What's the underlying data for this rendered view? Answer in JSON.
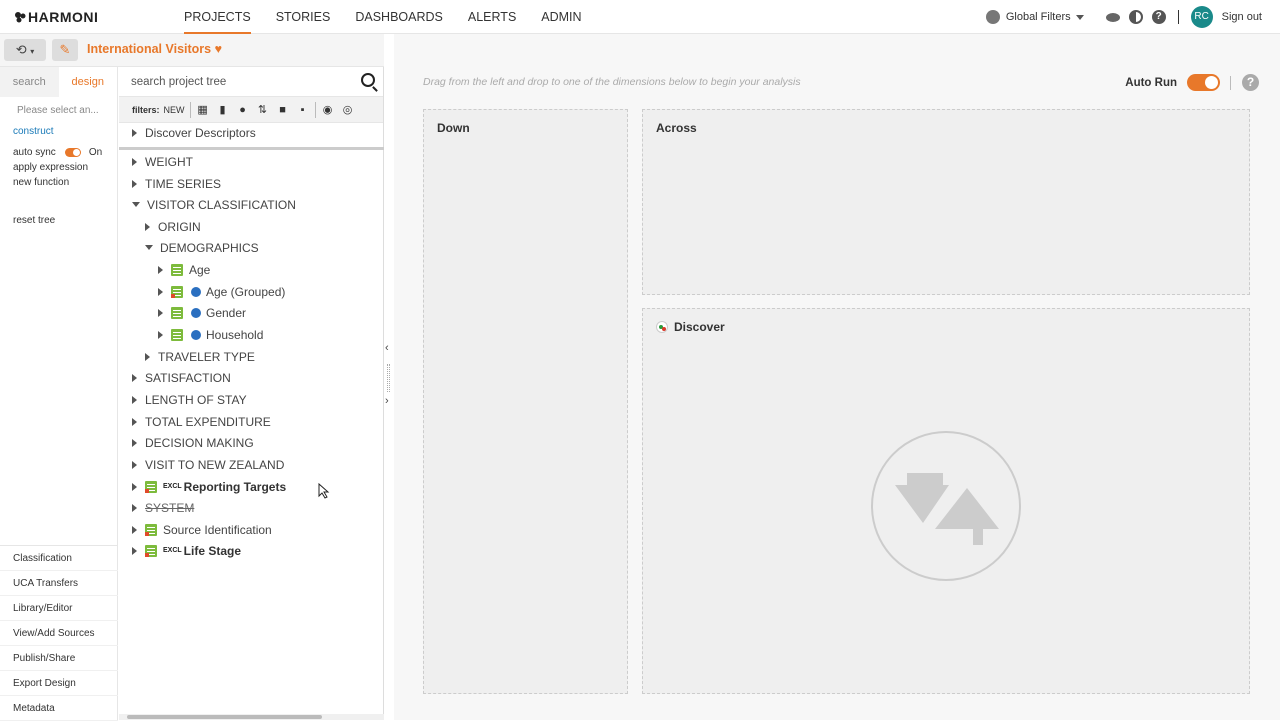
{
  "app": {
    "logo": "HARMONI"
  },
  "nav": {
    "items": [
      "PROJECTS",
      "STORIES",
      "DASHBOARDS",
      "ALERTS",
      "ADMIN"
    ],
    "active": "PROJECTS"
  },
  "topright": {
    "global_filters": "Global Filters",
    "avatar_initials": "RC",
    "signout": "Sign out"
  },
  "project": {
    "title": "International Visitors",
    "accent": "#e8782a"
  },
  "leftpanel": {
    "tabs": [
      "search",
      "design"
    ],
    "active_tab": "design",
    "please_select": "Please select an...",
    "construct": "construct",
    "auto_sync_label": "auto sync",
    "auto_sync_state": "On",
    "apply_expression": "apply expression",
    "new_function": "new function",
    "reset_tree": "reset tree",
    "bottom_links": [
      "Classification",
      "UCA Transfers",
      "Library/Editor",
      "View/Add Sources",
      "Publish/Share",
      "Export Design",
      "Metadata"
    ]
  },
  "tree": {
    "search_placeholder": "search project tree",
    "filters_label": "filters:",
    "filters_new": "NEW",
    "items": [
      {
        "label": "Discover Descriptors"
      },
      {
        "label": "WEIGHT"
      },
      {
        "label": "TIME SERIES"
      },
      {
        "label": "VISITOR CLASSIFICATION"
      },
      {
        "label": "ORIGIN"
      },
      {
        "label": "DEMOGRAPHICS"
      },
      {
        "label": "Age"
      },
      {
        "label": "Age (Grouped)"
      },
      {
        "label": "Gender"
      },
      {
        "label": "Household"
      },
      {
        "label": "TRAVELER TYPE"
      },
      {
        "label": "SATISFACTION"
      },
      {
        "label": "LENGTH OF STAY"
      },
      {
        "label": "TOTAL EXPENDITURE"
      },
      {
        "label": "DECISION MAKING"
      },
      {
        "label": "VISIT TO NEW ZEALAND"
      },
      {
        "label": "Reporting Targets",
        "excl": "EXCL"
      },
      {
        "label": "SYSTEM"
      },
      {
        "label": "Source Identification"
      },
      {
        "label": "Life Stage",
        "excl": "EXCL"
      }
    ]
  },
  "canvas": {
    "hint": "Drag from the left and drop to one of the dimensions below to begin your analysis",
    "auto_run": "Auto Run",
    "down": "Down",
    "across": "Across",
    "discover": "Discover"
  }
}
